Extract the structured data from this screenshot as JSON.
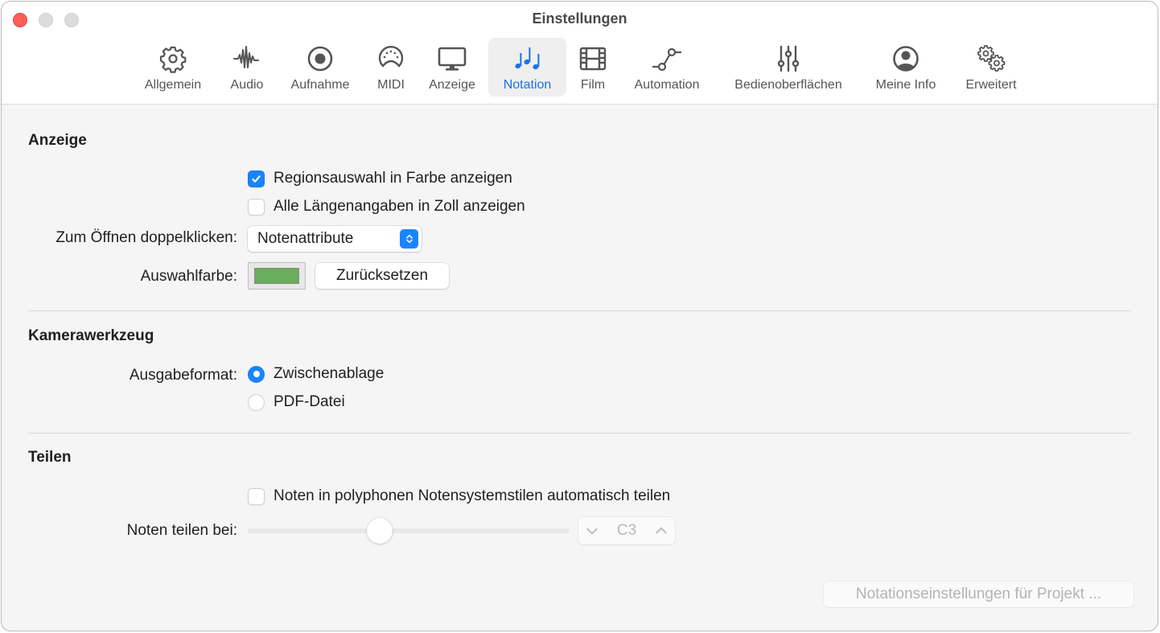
{
  "window": {
    "title": "Einstellungen"
  },
  "toolbar": {
    "active": "Notation",
    "accent_color": "#1a73e8",
    "items": [
      {
        "label": "Allgemein",
        "icon": "gear-icon"
      },
      {
        "label": "Audio",
        "icon": "waveform-icon"
      },
      {
        "label": "Aufnahme",
        "icon": "record-icon"
      },
      {
        "label": "MIDI",
        "icon": "midi-connector-icon"
      },
      {
        "label": "Anzeige",
        "icon": "display-icon"
      },
      {
        "label": "Notation",
        "icon": "music-notes-icon"
      },
      {
        "label": "Film",
        "icon": "film-icon"
      },
      {
        "label": "Automation",
        "icon": "automation-curve-icon"
      },
      {
        "label": "Bedienoberflächen",
        "icon": "sliders-icon"
      },
      {
        "label": "Meine Info",
        "icon": "person-circle-icon"
      },
      {
        "label": "Erweitert",
        "icon": "gears-icon"
      }
    ]
  },
  "sections": {
    "anzeige": {
      "title": "Anzeige",
      "checkbox_color_region": {
        "label": "Regionsauswahl in Farbe anzeigen",
        "checked": true
      },
      "checkbox_inches": {
        "label": "Alle Längenangaben in Zoll anzeigen",
        "checked": false
      },
      "double_click": {
        "label": "Zum Öffnen doppelklicken:",
        "value": "Notenattribute"
      },
      "selection_color": {
        "label": "Auswahlfarbe:",
        "color": "#6aad5c",
        "reset_label": "Zurücksetzen"
      }
    },
    "kamera": {
      "title": "Kamerawerkzeug",
      "output_format": {
        "label": "Ausgabeformat:",
        "options": [
          {
            "label": "Zwischenablage",
            "selected": true
          },
          {
            "label": "PDF-Datei",
            "selected": false
          }
        ]
      }
    },
    "teilen": {
      "title": "Teilen",
      "checkbox_auto_split": {
        "label": "Noten in polyphonen Notensystemstilen automatisch teilen",
        "checked": false
      },
      "split_at": {
        "label": "Noten teilen bei:",
        "slider_fraction": 0.41,
        "value": "C3",
        "enabled": false
      }
    }
  },
  "footer": {
    "project_settings_label": "Notationseinstellungen für Projekt ...",
    "enabled": false
  }
}
